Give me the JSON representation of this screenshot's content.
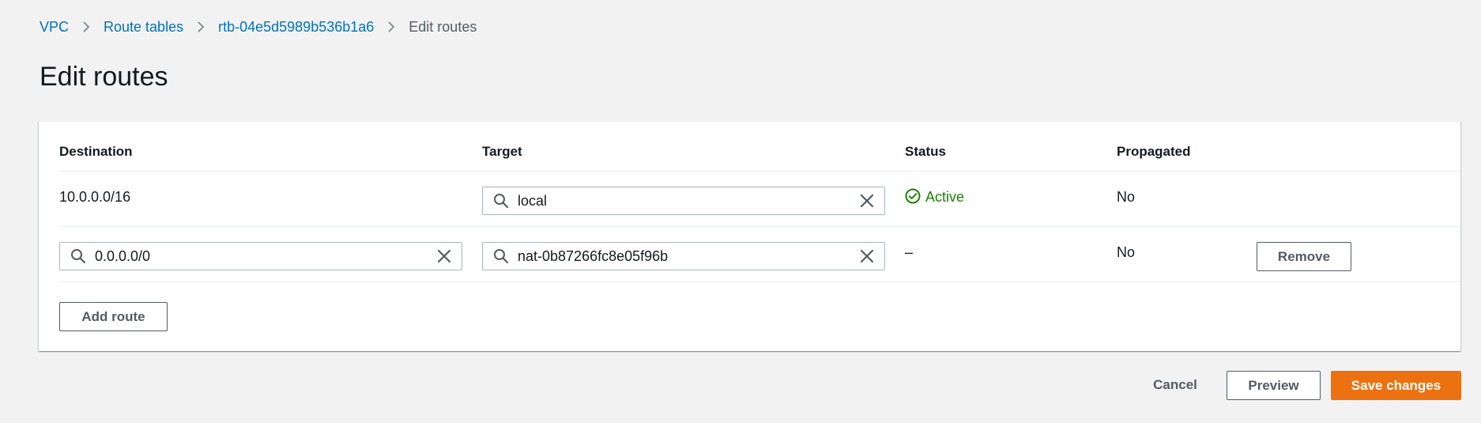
{
  "breadcrumb": {
    "items": [
      {
        "label": "VPC"
      },
      {
        "label": "Route tables"
      },
      {
        "label": "rtb-04e5d5989b536b1a6"
      }
    ],
    "current": "Edit routes"
  },
  "page": {
    "title": "Edit routes"
  },
  "table": {
    "columns": {
      "destination": "Destination",
      "target": "Target",
      "status": "Status",
      "propagated": "Propagated"
    },
    "rows": [
      {
        "destination": "10.0.0.0/16",
        "target": "local",
        "status": "Active",
        "propagated": "No"
      },
      {
        "destination": "0.0.0.0/0",
        "target": "nat-0b87266fc8e05f96b",
        "status": "–",
        "propagated": "No",
        "remove_label": "Remove"
      }
    ],
    "add_route_label": "Add route"
  },
  "footer": {
    "cancel_label": "Cancel",
    "preview_label": "Preview",
    "save_label": "Save changes"
  },
  "colors": {
    "link": "#0073bb",
    "status_active": "#1d8102",
    "primary": "#ec7211",
    "background": "#f2f2f2"
  },
  "icons": {
    "breadcrumb_separator": "chevron-right-icon",
    "input_search": "search-icon",
    "input_clear": "close-icon",
    "status_ok": "check-circle-icon"
  }
}
